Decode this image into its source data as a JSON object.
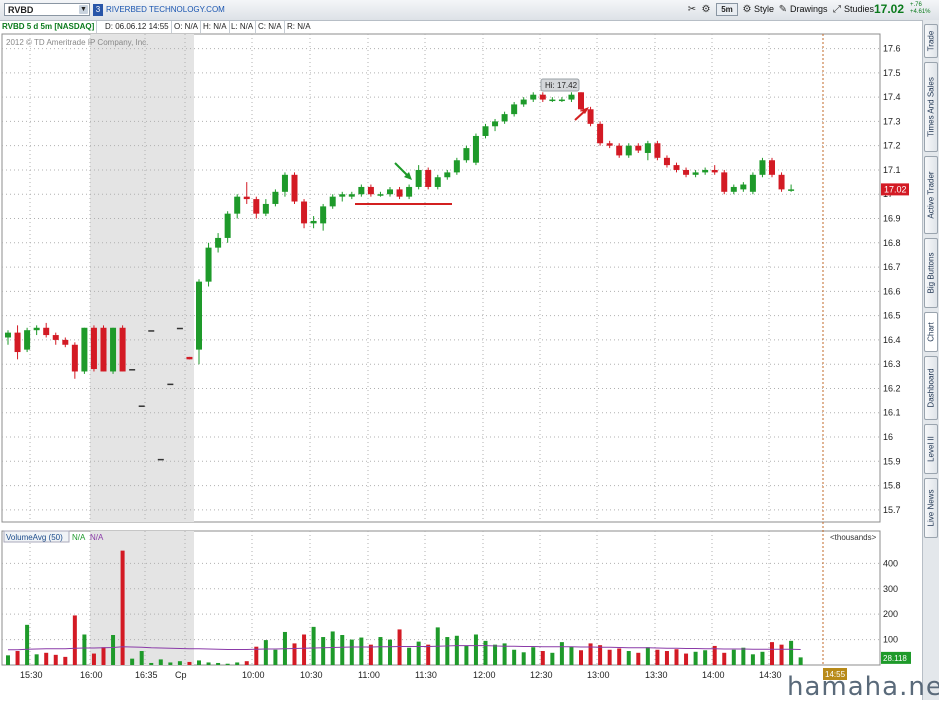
{
  "toolbar": {
    "symbol": "RVBD",
    "link_number": "3",
    "company": "RIVERBED TECHNOLOGY.COM",
    "interval": "5m",
    "style_label": "Style",
    "drawings_label": "Drawings",
    "studies_label": "Studies",
    "last_price": "17.02",
    "change_abs": "+.76",
    "change_pct": "+4.61%"
  },
  "infobar": {
    "title": "RVBD 5 d 5m [NASDAQ]",
    "date": "D: 06.06.12 14:55",
    "open": "O: N/A",
    "high": "H: N/A",
    "low": "L: N/A",
    "close": "C: N/A",
    "range": "R: N/A"
  },
  "copyright": "2012 © TD Ameritrade IP Company, Inc.",
  "sidebar_tabs": [
    "Trade",
    "Times And Sales",
    "Active Trader",
    "Big Buttons",
    "Chart",
    "Dashboard",
    "Level II",
    "Live News"
  ],
  "price_marker": "17.02",
  "time_marker": "14:55",
  "watermark": "hamaha.net",
  "colors": {
    "up": "#1e9a2a",
    "down": "#d31a24",
    "avg": "#8a3aa8",
    "grid": "#b0b0b0",
    "session_shade": "#e4e4e4"
  },
  "chart_data": {
    "type": "candlestick",
    "price_axis": {
      "min": 15.65,
      "max": 17.66,
      "ticks": [
        15.7,
        15.8,
        15.9,
        16,
        16.1,
        16.2,
        16.3,
        16.4,
        16.5,
        16.6,
        16.7,
        16.8,
        16.9,
        17,
        17.1,
        17.2,
        17.3,
        17.4,
        17.5,
        17.6
      ],
      "tick_labels": [
        "15.7",
        "15.8",
        "15.9",
        "16",
        "16.1",
        "16.2",
        "16.3",
        "16.4",
        "16.5",
        "16.6",
        "16.7",
        "16.8",
        "16.9",
        "17",
        "17.1",
        "17.2",
        "17.3",
        "17.4",
        "17.5",
        "17.6"
      ]
    },
    "time_labels": [
      "15:30",
      "16:00",
      "16:35",
      "Cp",
      "10:00",
      "10:30",
      "11:00",
      "11:30",
      "12:00",
      "12:30",
      "13:00",
      "13:30",
      "14:00",
      "14:30"
    ],
    "high_annotation": "Hi: 17.42",
    "candles": [
      {
        "o": 16.41,
        "h": 16.44,
        "l": 16.38,
        "c": 16.43
      },
      {
        "o": 16.43,
        "h": 16.46,
        "l": 16.32,
        "c": 16.35
      },
      {
        "o": 16.36,
        "h": 16.45,
        "l": 16.35,
        "c": 16.44
      },
      {
        "o": 16.44,
        "h": 16.46,
        "l": 16.42,
        "c": 16.45
      },
      {
        "o": 16.45,
        "h": 16.47,
        "l": 16.41,
        "c": 16.42
      },
      {
        "o": 16.42,
        "h": 16.43,
        "l": 16.38,
        "c": 16.4
      },
      {
        "o": 16.4,
        "h": 16.41,
        "l": 16.37,
        "c": 16.38
      },
      {
        "o": 16.38,
        "h": 16.39,
        "l": 16.24,
        "c": 16.27
      },
      {
        "o": 16.27,
        "h": 16.45,
        "l": 16.26,
        "c": 16.45
      },
      {
        "o": 16.45,
        "h": 16.46,
        "l": 16.27,
        "c": 16.28
      },
      {
        "o": 16.45,
        "h": 16.46,
        "l": 16.27,
        "c": 16.27
      },
      {
        "o": 16.27,
        "h": 16.45,
        "l": 16.26,
        "c": 16.45
      },
      {
        "o": 16.45,
        "h": 16.46,
        "l": 16.27,
        "c": 16.27
      },
      {
        "o": 16.28,
        "h": 16.28,
        "l": 16.28,
        "c": 16.28
      },
      {
        "o": 16.13,
        "h": 16.13,
        "l": 16.13,
        "c": 16.13
      },
      {
        "o": 16.44,
        "h": 16.44,
        "l": 16.44,
        "c": 16.44
      },
      {
        "o": 15.91,
        "h": 15.91,
        "l": 15.91,
        "c": 15.91
      },
      {
        "o": 16.22,
        "h": 16.22,
        "l": 16.22,
        "c": 16.22
      },
      {
        "o": 16.45,
        "h": 16.45,
        "l": 16.45,
        "c": 16.45
      },
      {
        "o": 16.33,
        "h": 16.33,
        "l": 16.32,
        "c": 16.32
      },
      {
        "o": 16.36,
        "h": 16.65,
        "l": 16.3,
        "c": 16.64
      },
      {
        "o": 16.64,
        "h": 16.8,
        "l": 16.62,
        "c": 16.78
      },
      {
        "o": 16.78,
        "h": 16.84,
        "l": 16.76,
        "c": 16.82
      },
      {
        "o": 16.82,
        "h": 16.93,
        "l": 16.8,
        "c": 16.92
      },
      {
        "o": 16.92,
        "h": 17.0,
        "l": 16.9,
        "c": 16.99
      },
      {
        "o": 16.99,
        "h": 17.05,
        "l": 16.96,
        "c": 16.98
      },
      {
        "o": 16.98,
        "h": 16.99,
        "l": 16.9,
        "c": 16.92
      },
      {
        "o": 16.92,
        "h": 16.98,
        "l": 16.91,
        "c": 16.96
      },
      {
        "o": 16.96,
        "h": 17.02,
        "l": 16.95,
        "c": 17.01
      },
      {
        "o": 17.01,
        "h": 17.09,
        "l": 16.99,
        "c": 17.08
      },
      {
        "o": 17.08,
        "h": 17.09,
        "l": 16.96,
        "c": 16.97
      },
      {
        "o": 16.97,
        "h": 16.98,
        "l": 16.86,
        "c": 16.88
      },
      {
        "o": 16.88,
        "h": 16.91,
        "l": 16.86,
        "c": 16.89
      },
      {
        "o": 16.88,
        "h": 16.96,
        "l": 16.85,
        "c": 16.95
      },
      {
        "o": 16.95,
        "h": 17.0,
        "l": 16.94,
        "c": 16.99
      },
      {
        "o": 16.99,
        "h": 17.01,
        "l": 16.97,
        "c": 17.0
      },
      {
        "o": 16.99,
        "h": 17.01,
        "l": 16.98,
        "c": 17.0
      },
      {
        "o": 17.0,
        "h": 17.04,
        "l": 16.99,
        "c": 17.03
      },
      {
        "o": 17.03,
        "h": 17.04,
        "l": 16.99,
        "c": 17.0
      },
      {
        "o": 17.0,
        "h": 17.01,
        "l": 16.99,
        "c": 17.0
      },
      {
        "o": 17.0,
        "h": 17.03,
        "l": 16.99,
        "c": 17.02
      },
      {
        "o": 17.02,
        "h": 17.03,
        "l": 16.98,
        "c": 16.99
      },
      {
        "o": 16.99,
        "h": 17.04,
        "l": 16.98,
        "c": 17.03
      },
      {
        "o": 17.03,
        "h": 17.12,
        "l": 17.02,
        "c": 17.1
      },
      {
        "o": 17.1,
        "h": 17.11,
        "l": 17.02,
        "c": 17.03
      },
      {
        "o": 17.03,
        "h": 17.08,
        "l": 17.02,
        "c": 17.07
      },
      {
        "o": 17.07,
        "h": 17.1,
        "l": 17.06,
        "c": 17.09
      },
      {
        "o": 17.09,
        "h": 17.15,
        "l": 17.08,
        "c": 17.14
      },
      {
        "o": 17.14,
        "h": 17.2,
        "l": 17.13,
        "c": 17.19
      },
      {
        "o": 17.13,
        "h": 17.25,
        "l": 17.12,
        "c": 17.24
      },
      {
        "o": 17.24,
        "h": 17.29,
        "l": 17.23,
        "c": 17.28
      },
      {
        "o": 17.28,
        "h": 17.31,
        "l": 17.26,
        "c": 17.3
      },
      {
        "o": 17.3,
        "h": 17.34,
        "l": 17.29,
        "c": 17.33
      },
      {
        "o": 17.33,
        "h": 17.38,
        "l": 17.32,
        "c": 17.37
      },
      {
        "o": 17.37,
        "h": 17.4,
        "l": 17.36,
        "c": 17.39
      },
      {
        "o": 17.39,
        "h": 17.42,
        "l": 17.38,
        "c": 17.41
      },
      {
        "o": 17.41,
        "h": 17.42,
        "l": 17.38,
        "c": 17.39
      },
      {
        "o": 17.39,
        "h": 17.4,
        "l": 17.38,
        "c": 17.39
      },
      {
        "o": 17.39,
        "h": 17.4,
        "l": 17.38,
        "c": 17.39
      },
      {
        "o": 17.39,
        "h": 17.42,
        "l": 17.38,
        "c": 17.41
      },
      {
        "o": 17.42,
        "h": 17.42,
        "l": 17.34,
        "c": 17.35
      },
      {
        "o": 17.35,
        "h": 17.36,
        "l": 17.28,
        "c": 17.29
      },
      {
        "o": 17.29,
        "h": 17.3,
        "l": 17.2,
        "c": 17.21
      },
      {
        "o": 17.21,
        "h": 17.22,
        "l": 17.19,
        "c": 17.2
      },
      {
        "o": 17.2,
        "h": 17.21,
        "l": 17.15,
        "c": 17.16
      },
      {
        "o": 17.16,
        "h": 17.21,
        "l": 17.15,
        "c": 17.2
      },
      {
        "o": 17.2,
        "h": 17.21,
        "l": 17.17,
        "c": 17.18
      },
      {
        "o": 17.17,
        "h": 17.22,
        "l": 17.14,
        "c": 17.21
      },
      {
        "o": 17.21,
        "h": 17.22,
        "l": 17.14,
        "c": 17.15
      },
      {
        "o": 17.15,
        "h": 17.16,
        "l": 17.11,
        "c": 17.12
      },
      {
        "o": 17.12,
        "h": 17.13,
        "l": 17.09,
        "c": 17.1
      },
      {
        "o": 17.1,
        "h": 17.11,
        "l": 17.07,
        "c": 17.08
      },
      {
        "o": 17.08,
        "h": 17.1,
        "l": 17.07,
        "c": 17.09
      },
      {
        "o": 17.09,
        "h": 17.11,
        "l": 17.08,
        "c": 17.1
      },
      {
        "o": 17.1,
        "h": 17.12,
        "l": 17.08,
        "c": 17.09
      },
      {
        "o": 17.09,
        "h": 17.1,
        "l": 17.0,
        "c": 17.01
      },
      {
        "o": 17.01,
        "h": 17.04,
        "l": 17.0,
        "c": 17.03
      },
      {
        "o": 17.02,
        "h": 17.05,
        "l": 17.01,
        "c": 17.04
      },
      {
        "o": 17.01,
        "h": 17.09,
        "l": 17.0,
        "c": 17.08
      },
      {
        "o": 17.08,
        "h": 17.15,
        "l": 17.07,
        "c": 17.14
      },
      {
        "o": 17.14,
        "h": 17.15,
        "l": 17.07,
        "c": 17.08
      },
      {
        "o": 17.08,
        "h": 17.09,
        "l": 17.01,
        "c": 17.02
      },
      {
        "o": 17.02,
        "h": 17.04,
        "l": 17.01,
        "c": 17.02
      }
    ],
    "volume_axis": {
      "min": 0,
      "max": 480,
      "ticks": [
        100,
        200,
        300,
        400
      ],
      "tick_labels": [
        "100",
        "200",
        "300",
        "400"
      ],
      "unit_label": "<thousands>"
    },
    "volume_study": {
      "label": "VolumeAvg (50)",
      "value1": "N/A",
      "value2": "N/A",
      "last": "28.118"
    },
    "volumes": [
      38,
      55,
      158,
      42,
      48,
      40,
      32,
      195,
      120,
      45,
      70,
      118,
      450,
      25,
      55,
      8,
      22,
      10,
      15,
      12,
      18,
      10,
      8,
      5,
      10,
      15,
      72,
      98,
      60,
      130,
      85,
      120,
      150,
      110,
      132,
      118,
      100,
      108,
      80,
      110,
      100,
      140,
      68,
      92,
      80,
      148,
      110,
      115,
      75,
      120,
      95,
      80,
      85,
      60,
      50,
      70,
      55,
      48,
      90,
      72,
      58,
      85,
      78,
      60,
      65,
      55,
      48,
      70,
      60,
      55,
      62,
      45,
      52,
      58,
      75,
      48,
      60,
      68,
      42,
      52,
      90,
      80,
      95,
      30
    ],
    "volume_avg": [
      60,
      60,
      62,
      63,
      64,
      64,
      64,
      66,
      67,
      67,
      68,
      69,
      72,
      71,
      70,
      68,
      67,
      66,
      65,
      64,
      64,
      63,
      62,
      61,
      61,
      61,
      62,
      63,
      63,
      64,
      65,
      66,
      67,
      68,
      69,
      70,
      71,
      71,
      71,
      72,
      72,
      73,
      73,
      73,
      73,
      74,
      75,
      76,
      76,
      76,
      76,
      75,
      74,
      74,
      73,
      73,
      72,
      72,
      72,
      72,
      71,
      71,
      70,
      70,
      69,
      68,
      68,
      68,
      67,
      66,
      66,
      65,
      65,
      64,
      64,
      63,
      63,
      63,
      62,
      62,
      62,
      62,
      62,
      61
    ]
  }
}
